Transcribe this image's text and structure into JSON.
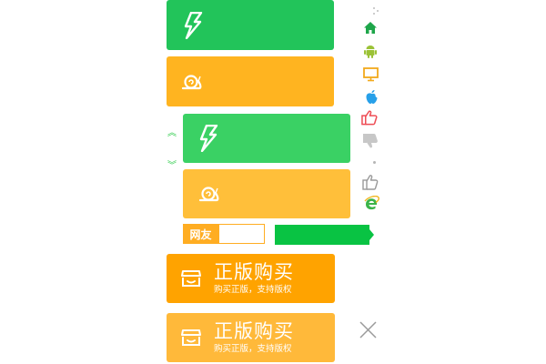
{
  "colors": {
    "green": "#22c45a",
    "green_light": "#3ad164",
    "orange": "#ffb420",
    "orange_light": "#ffbf3a",
    "orange_deep": "#ffa300",
    "net_green": "#09c343"
  },
  "tiles": [
    {
      "icon": "lightning-icon"
    },
    {
      "icon": "snail-icon"
    },
    {
      "icon": "lightning-icon"
    },
    {
      "icon": "snail-icon"
    }
  ],
  "net_friend": {
    "label": "网友",
    "placeholder": ""
  },
  "buy_buttons": [
    {
      "title": "正版购买",
      "subtitle": "购买正版，支持版权"
    },
    {
      "title": "正版购买",
      "subtitle": "购买正版，支持版权"
    }
  ],
  "arrows": {
    "up": "︽",
    "down": "︾"
  },
  "side_icons": [
    "dots-icon",
    "home-icon",
    "android-icon",
    "monitor-icon",
    "apple-icon",
    "thumbs-up-red-icon",
    "thumbs-down-gray-icon",
    "small-dot-icon",
    "thumbs-up-gray-icon",
    "ie-icon"
  ]
}
